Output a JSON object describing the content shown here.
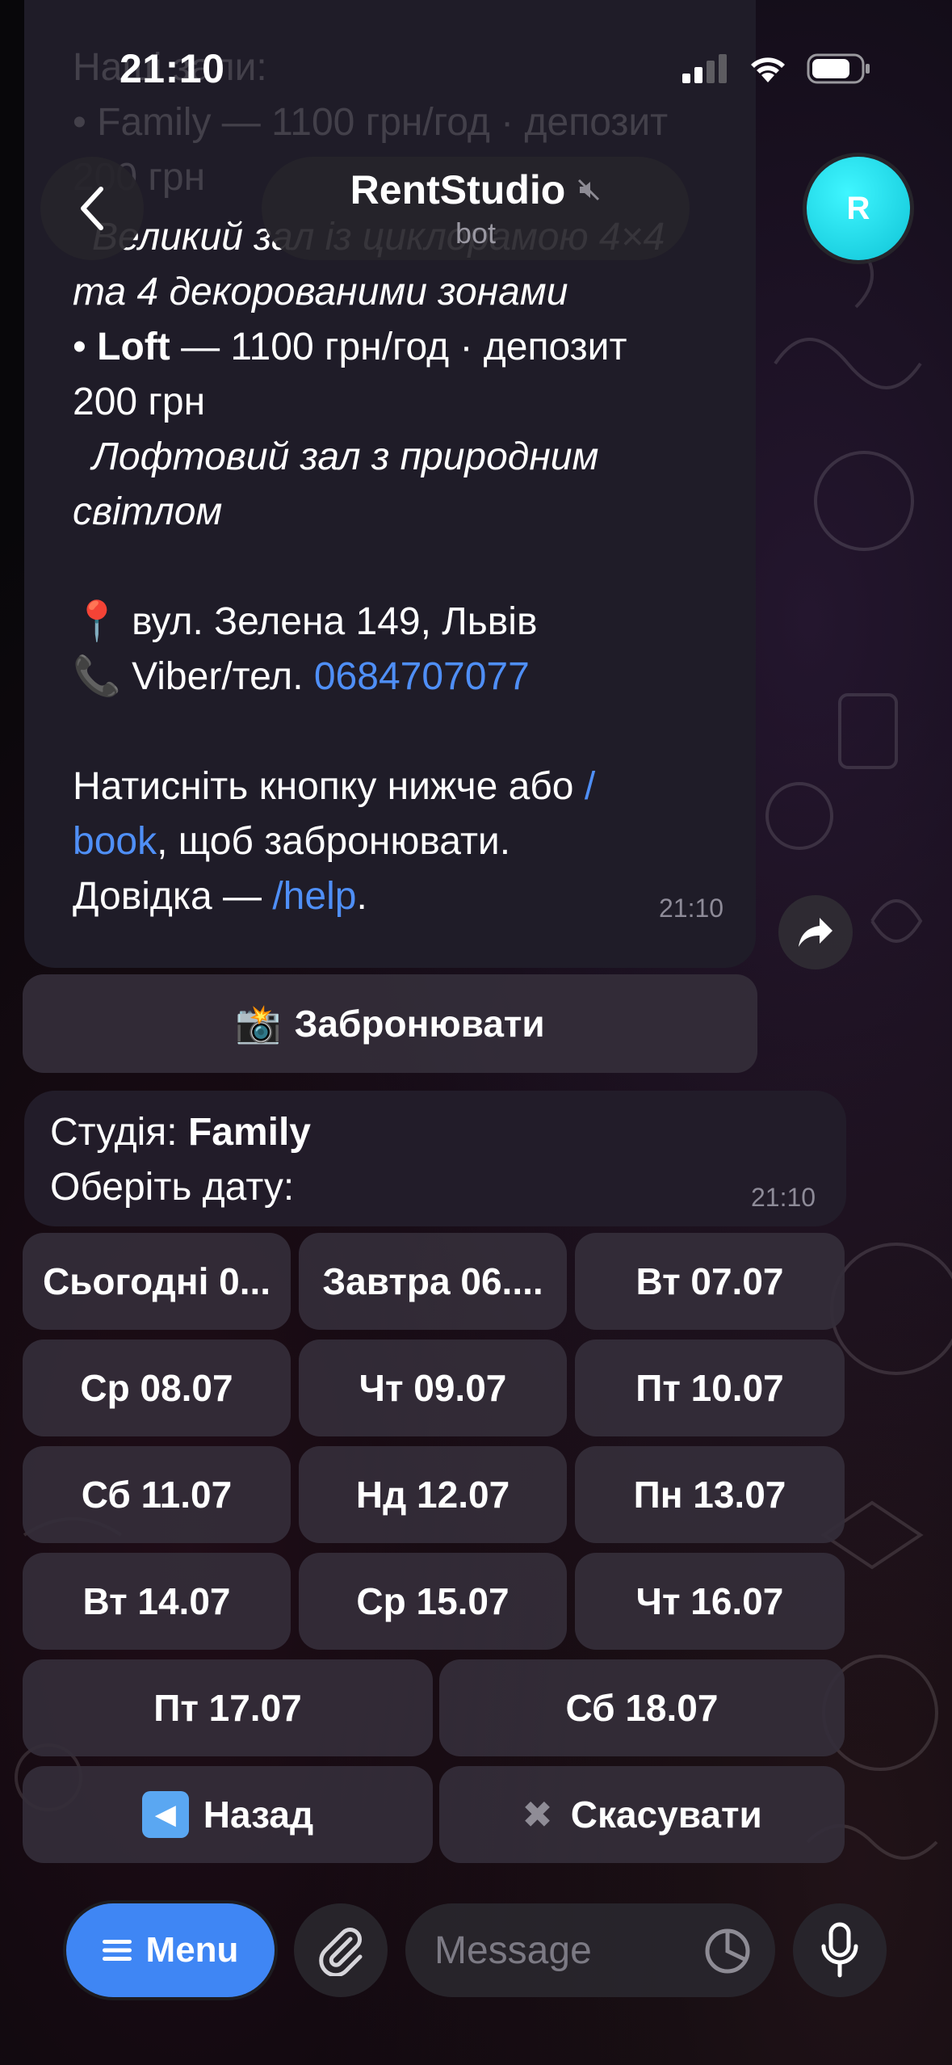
{
  "status": {
    "time": "21:10"
  },
  "header": {
    "title": "RentStudio",
    "subtitle": "bot",
    "avatar_letter": "R"
  },
  "message1": {
    "faded_lines": [
      "Наші зали:",
      "• Family — 1100 грн/год · депозит",
      "200 грн"
    ],
    "line1": "Великий зал із циклорамою 4×4",
    "line2": "та 4 декорованими зонами",
    "loft_bullet": "• ",
    "loft_name": "Loft",
    "loft_price": " — 1100 грн/год · депозит",
    "loft_deposit": "200 грн",
    "loft_desc1": "Лофтовий зал з природним",
    "loft_desc2": "світлом",
    "address_icon": "📍",
    "address": "вул. Зелена 149, Львів",
    "phone_icon": "📞",
    "phone_label": "Viber/тел. ",
    "phone_number": "0684707077",
    "cta_part1": "Натисніть кнопку нижче або ",
    "cta_link1": "/",
    "cta_link2": "book",
    "cta_part2": ", щоб забронювати.",
    "help_part": "Довідка — ",
    "help_link": "/help",
    "help_end": ".",
    "time": "21:10"
  },
  "book_button": {
    "icon": "📸",
    "label": "Забронювати"
  },
  "message2": {
    "studio_label": "Студія: ",
    "studio_name": "Family",
    "prompt": "Оберіть дату:",
    "time": "21:10"
  },
  "dates": [
    "Сьогодні 0...",
    "Завтра 06....",
    "Вт 07.07",
    "Ср 08.07",
    "Чт 09.07",
    "Пт 10.07",
    "Сб 11.07",
    "Нд 12.07",
    "Пн 13.07",
    "Вт 14.07",
    "Ср 15.07",
    "Чт 16.07",
    "Пт 17.07",
    "Сб 18.07"
  ],
  "nav_buttons": {
    "back_icon": "◀",
    "back_label": "Назад",
    "cancel_icon": "✖",
    "cancel_label": "Скасувати"
  },
  "input_bar": {
    "menu_label": "Menu",
    "placeholder": "Message"
  }
}
